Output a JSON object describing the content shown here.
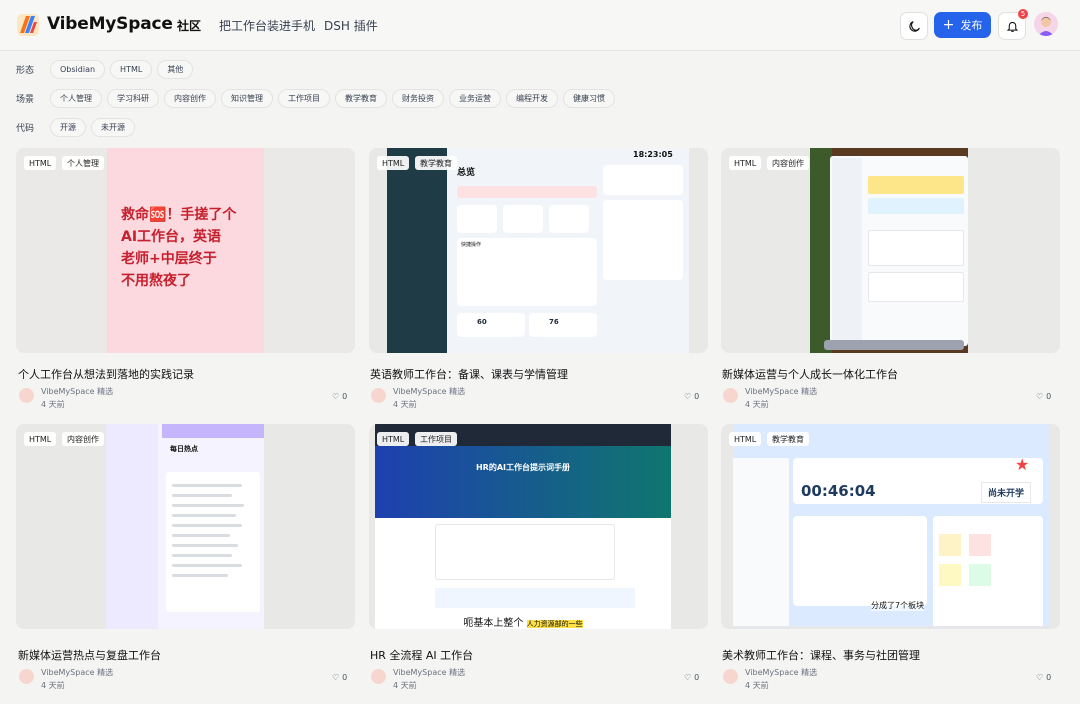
{
  "brand": "VibeMySpace",
  "nav": [
    {
      "label": "社区",
      "active": true
    },
    {
      "label": "把工作台装进手机",
      "active": false
    },
    {
      "label": "DSH 插件",
      "active": false
    }
  ],
  "header": {
    "publish_label": "发布",
    "notification_count": "5"
  },
  "filters": {
    "form": {
      "label": "形态",
      "chips": [
        "Obsidian",
        "HTML",
        "其他"
      ]
    },
    "scene": {
      "label": "场景",
      "chips": [
        "个人管理",
        "学习科研",
        "内容创作",
        "知识管理",
        "工作项目",
        "教学教育",
        "财务投资",
        "业务运营",
        "编程开发",
        "健康习惯"
      ]
    },
    "code": {
      "label": "代码",
      "chips": [
        "开源",
        "未开源"
      ]
    }
  },
  "cards": [
    {
      "tags": [
        "HTML",
        "个人管理"
      ],
      "title": "个人工作台从想法到落地的实践记录",
      "author": "VibeMySpace 精选",
      "time": "4 天前",
      "likes": "0",
      "image_text": [
        "救命🆘！手搓了个",
        "AI工作台，英语",
        "老师+中层终于",
        "不用熬夜了"
      ]
    },
    {
      "tags": [
        "HTML",
        "教学教育"
      ],
      "title": "英语教师工作台：备课、课表与学情管理",
      "author": "VibeMySpace 精选",
      "time": "4 天前",
      "likes": "0",
      "image_text": [
        "总览",
        "18:23:05",
        "快捷操作",
        "60",
        "76"
      ]
    },
    {
      "tags": [
        "HTML",
        "内容创作"
      ],
      "title": "新媒体运营与个人成长一体化工作台",
      "author": "VibeMySpace 精选",
      "time": "4 天前",
      "likes": "0"
    },
    {
      "tags": [
        "HTML",
        "内容创作"
      ],
      "title": "新媒体运营热点与复盘工作台",
      "author": "VibeMySpace 精选",
      "time": "4 天前",
      "likes": "0",
      "image_text": [
        "每日热点"
      ]
    },
    {
      "tags": [
        "HTML",
        "工作项目"
      ],
      "title": "HR 全流程 AI 工作台",
      "author": "VibeMySpace 精选",
      "time": "4 天前",
      "likes": "0",
      "image_text": [
        "HR的AI工作台提示词手册",
        "呃基本上整个",
        "人力资源部的一些"
      ]
    },
    {
      "tags": [
        "HTML",
        "教学教育"
      ],
      "title": "美术教师工作台：课程、事务与社团管理",
      "author": "VibeMySpace 精选",
      "time": "4 天前",
      "likes": "0",
      "image_text": [
        "00:46:04",
        "尚未开学",
        "分成了7个板块"
      ]
    }
  ]
}
